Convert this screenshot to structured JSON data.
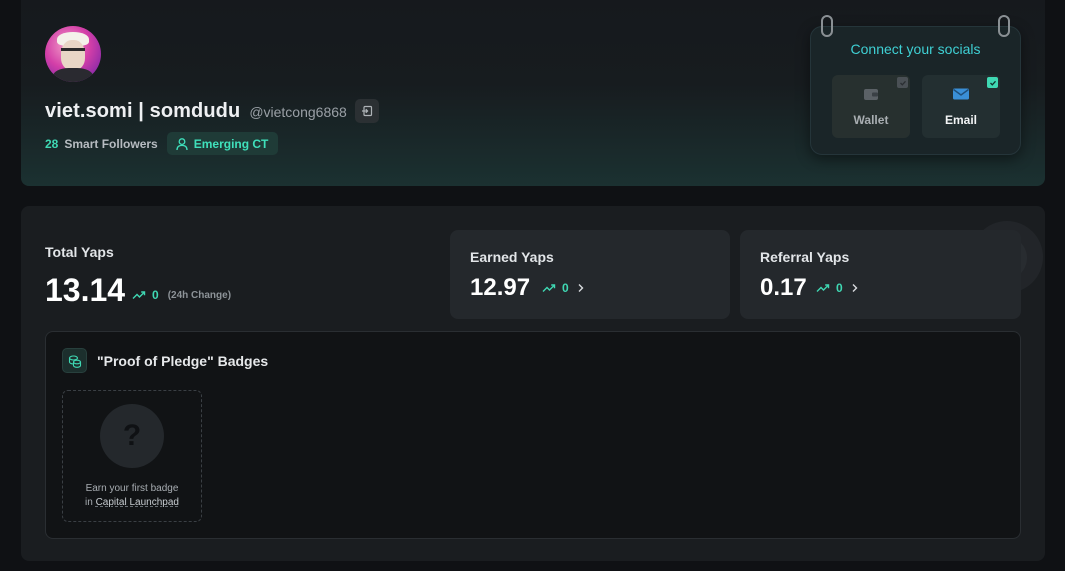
{
  "profile": {
    "display_name": "viet.somi | somdudu",
    "handle": "@vietcong6868",
    "followers_count": "28",
    "followers_label": "Smart Followers",
    "tier": "Emerging CT"
  },
  "socials": {
    "title": "Connect your socials",
    "wallet_label": "Wallet",
    "email_label": "Email"
  },
  "stats": {
    "total_label": "Total Yaps",
    "total_value": "13.14",
    "total_change": "0",
    "total_change_note": "(24h Change)",
    "earned_label": "Earned Yaps",
    "earned_value": "12.97",
    "earned_change": "0",
    "referral_label": "Referral Yaps",
    "referral_value": "0.17",
    "referral_change": "0"
  },
  "badges": {
    "title": "\"Proof of Pledge\" Badges",
    "empty_symbol": "?",
    "empty_text": "Earn your first badge",
    "empty_prefix": "in",
    "empty_link": "Capital Launchpad"
  },
  "colors": {
    "accent": "#3fd8b3",
    "socials_title": "#3fd0d4",
    "background": "#0f1114"
  }
}
